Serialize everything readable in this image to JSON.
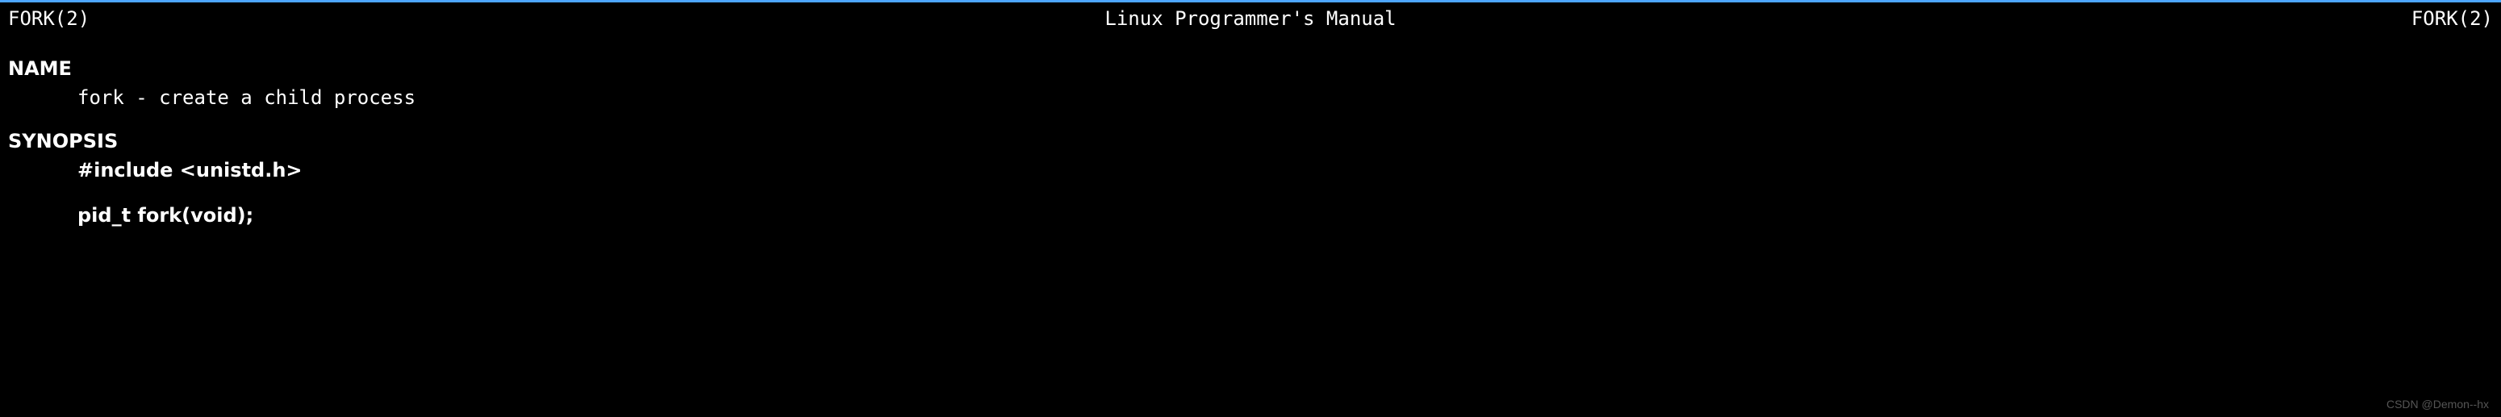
{
  "header": {
    "left": "FORK(2)",
    "center": "Linux Programmer's Manual",
    "right": "FORK(2)"
  },
  "sections": {
    "name": {
      "heading": "NAME",
      "content": "fork - create a child process"
    },
    "synopsis": {
      "heading": "SYNOPSIS",
      "include": "#include <unistd.h>",
      "declaration": "pid_t fork(void);"
    }
  },
  "watermark": "CSDN @Demon--hx"
}
